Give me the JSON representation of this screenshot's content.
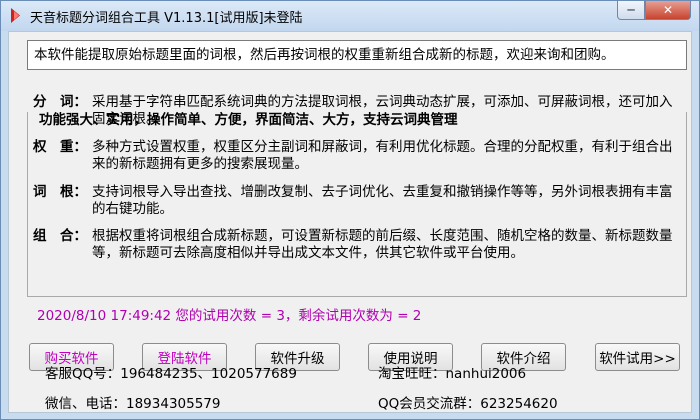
{
  "window": {
    "title": "天音标题分词组合工具 V1.13.1[试用版]未登陆",
    "controls": {
      "minimize_label": "─",
      "close_label": "✕"
    }
  },
  "banner": {
    "text": "本软件能提取原始标题里面的词根，然后再按词根的权重重新组合成新的标题，欢迎来询和团购。"
  },
  "features": {
    "heading": "功能强大、实用，操作简单、方便，界面简洁、大方，支持云词典管理",
    "items": [
      {
        "label": "分　词：",
        "desc": "采用基于字符串匹配系统词典的方法提取词根，云词典动态扩展，可添加、可屏蔽词根，还可加入固定词根。"
      },
      {
        "label": "权　重：",
        "desc": "多种方式设置权重，权重区分主副词和屏蔽词，有利用优化标题。合理的分配权重，有利于组合出来的新标题拥有更多的搜索展现量。"
      },
      {
        "label": "词　根：",
        "desc": "支持词根导入导出查找、增删改复制、去子词优化、去重复和撤销操作等等，另外词根表拥有丰富的右键功能。"
      },
      {
        "label": "组　合：",
        "desc": "根据权重将词根组合成新标题，可设置新标题的前后缀、长度范围、随机空格的数量、新标题数量等，新标题可去除高度相似并导出成文本文件，供其它软件或平台使用。"
      }
    ]
  },
  "status": {
    "text": "2020/8/10 17:49:42  您的试用次数 = 3，剩余试用次数为 = 2"
  },
  "buttons": {
    "buy": "购买软件",
    "login": "登陆软件",
    "upgrade": "软件升级",
    "manual": "使用说明",
    "intro": "软件介绍",
    "trial": "软件试用>>"
  },
  "contact": {
    "qq": "客服QQ号：196484235、1020577689",
    "taobao": "淘宝旺旺：nanhui2006",
    "phone": "微信、电话：18934305579",
    "group": "QQ会员交流群：623254620"
  },
  "colors": {
    "accent": "#c000c0",
    "status": "#b000b0",
    "window_frame": "#c8dcf0"
  },
  "icons": {
    "app": "app-logo-icon"
  }
}
